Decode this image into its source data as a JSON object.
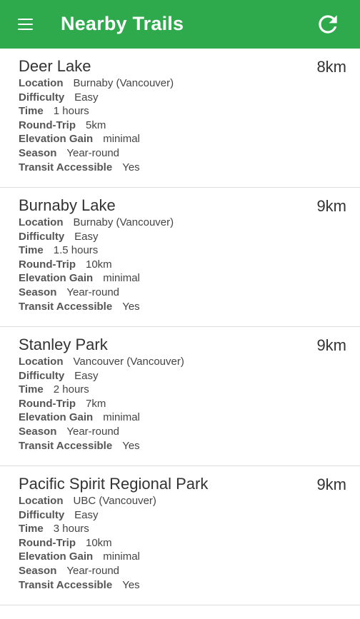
{
  "header": {
    "title": "Nearby Trails",
    "menu_icon": "hamburger-menu-icon",
    "refresh_icon": "refresh-icon",
    "color": "#2eaa4d"
  },
  "labels": {
    "location": "Location",
    "difficulty": "Difficulty",
    "time": "Time",
    "round_trip": "Round-Trip",
    "elevation_gain": "Elevation Gain",
    "season": "Season",
    "transit": "Transit Accessible"
  },
  "trails": [
    {
      "name": "Deer Lake",
      "distance": "8km",
      "location": "Burnaby (Vancouver)",
      "difficulty": "Easy",
      "time": "1 hours",
      "round_trip": "5km",
      "elevation_gain": "minimal",
      "season": "Year-round",
      "transit": "Yes"
    },
    {
      "name": "Burnaby Lake",
      "distance": "9km",
      "location": "Burnaby (Vancouver)",
      "difficulty": "Easy",
      "time": "1.5 hours",
      "round_trip": "10km",
      "elevation_gain": "minimal",
      "season": "Year-round",
      "transit": "Yes"
    },
    {
      "name": "Stanley Park",
      "distance": "9km",
      "location": "Vancouver (Vancouver)",
      "difficulty": "Easy",
      "time": "2 hours",
      "round_trip": "7km",
      "elevation_gain": "minimal",
      "season": "Year-round",
      "transit": "Yes"
    },
    {
      "name": "Pacific Spirit Regional Park",
      "distance": "9km",
      "location": "UBC (Vancouver)",
      "difficulty": "Easy",
      "time": "3 hours",
      "round_trip": "10km",
      "elevation_gain": "minimal",
      "season": "Year-round",
      "transit": "Yes"
    }
  ]
}
